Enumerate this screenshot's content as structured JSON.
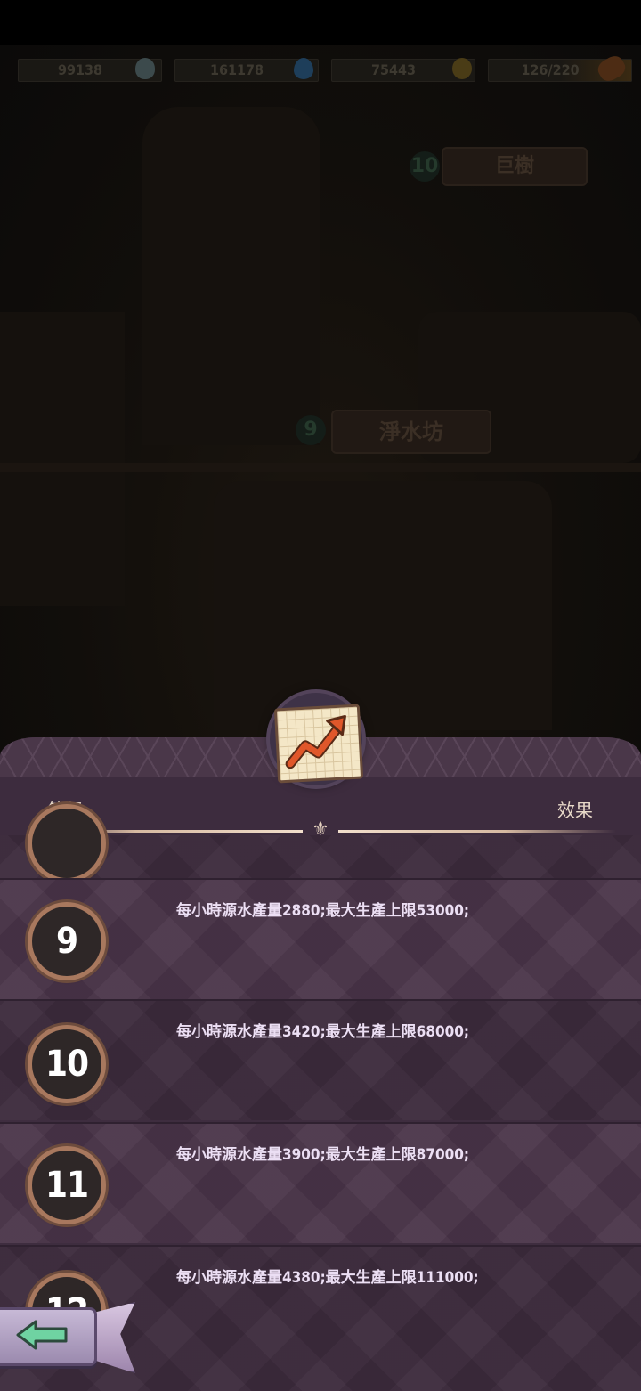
{
  "resources": [
    {
      "value": "99138",
      "icon": "stone-icon"
    },
    {
      "value": "161178",
      "icon": "water-drop-icon"
    },
    {
      "value": "75443",
      "icon": "coin-icon"
    },
    {
      "value": "126/220",
      "icon": "bread-icon"
    }
  ],
  "scene": {
    "top_sign_level": "10",
    "top_sign_label": "巨樹",
    "building_level": "9",
    "building_name": "淨水坊"
  },
  "panel": {
    "level_header": "等級",
    "effect_header": "效果",
    "rows": [
      {
        "level": "9",
        "effect": "每小時源水產量2880;最大生產上限53000;"
      },
      {
        "level": "10",
        "effect": "每小時源水產量3420;最大生產上限68000;"
      },
      {
        "level": "11",
        "effect": "每小時源水產量3900;最大生產上限87000;"
      },
      {
        "level": "12",
        "effect": "每小時源水產量4380;最大生產上限111000;"
      }
    ]
  },
  "colors": {
    "panel_bg": "#3e2d3f",
    "row_bg": "#4a3449",
    "accent_arrow": "#e0572a",
    "back_arrow": "#6fd3a2"
  }
}
